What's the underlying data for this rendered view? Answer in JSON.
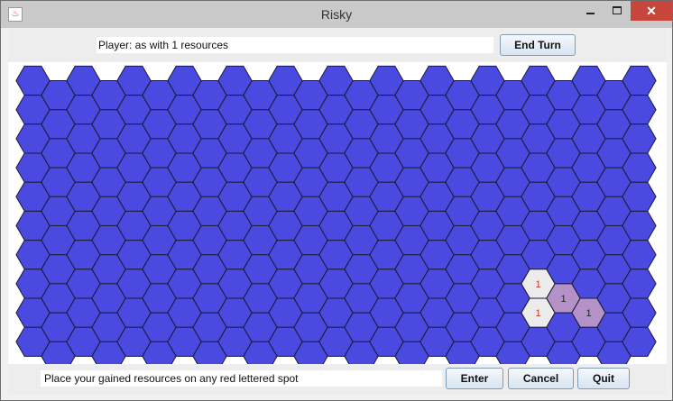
{
  "window": {
    "title": "Risky"
  },
  "header": {
    "player_text": "Player: as with 1 resources",
    "end_turn_label": "End Turn"
  },
  "footer": {
    "status_text": "Place your gained resources on any red lettered spot",
    "enter_label": "Enter",
    "cancel_label": "Cancel",
    "quit_label": "Quit"
  },
  "board": {
    "cols": 25,
    "rows": 10,
    "sea_color": "#4a4ae0",
    "highlight_color": "#ececec",
    "owned_color": "#b492c8",
    "label_red": "#c0392b",
    "label_dark": "#222222",
    "special_cells": [
      {
        "col": 20,
        "row": 7,
        "type": "highlight",
        "label": "1"
      },
      {
        "col": 21,
        "row": 7,
        "type": "owned",
        "label": "1"
      },
      {
        "col": 20,
        "row": 8,
        "type": "highlight",
        "label": "1"
      },
      {
        "col": 22,
        "row": 8,
        "type": "owned",
        "label": "1"
      }
    ]
  }
}
